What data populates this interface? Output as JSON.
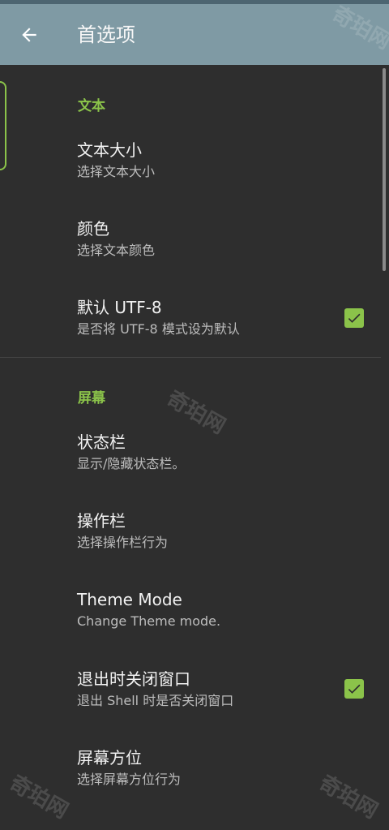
{
  "appbar": {
    "title": "首选项",
    "back_icon": "arrow-left-icon"
  },
  "sections": [
    {
      "header": "文本",
      "items": [
        {
          "title": "文本大小",
          "summary": "选择文本大小",
          "checked": null
        },
        {
          "title": "颜色",
          "summary": "选择文本颜色",
          "checked": null
        },
        {
          "title": "默认 UTF-8",
          "summary": "是否将 UTF-8 模式设为默认",
          "checked": true
        }
      ]
    },
    {
      "header": "屏幕",
      "items": [
        {
          "title": "状态栏",
          "summary": "显示/隐藏状态栏。",
          "checked": null
        },
        {
          "title": "操作栏",
          "summary": "选择操作栏行为",
          "checked": null
        },
        {
          "title": "Theme Mode",
          "summary": "Change Theme mode.",
          "checked": null
        },
        {
          "title": "退出时关闭窗口",
          "summary": "退出 Shell 时是否关闭窗口",
          "checked": true
        },
        {
          "title": "屏幕方位",
          "summary": "选择屏幕方位行为",
          "checked": null
        }
      ]
    }
  ],
  "watermark": "奇珀网",
  "colors": {
    "accent": "#8bc34a",
    "appbar": "#7f9aa4",
    "background": "#2e2e2e"
  }
}
